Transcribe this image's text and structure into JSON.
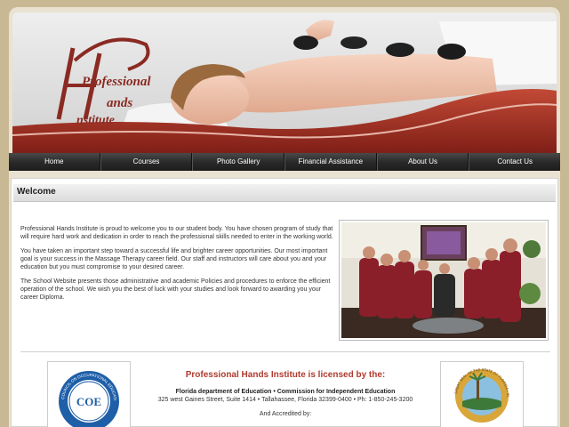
{
  "brand": {
    "logo_line1": "Professional",
    "logo_line2": "ands",
    "logo_line3": "nstitute"
  },
  "nav": {
    "items": [
      {
        "label": "Home"
      },
      {
        "label": "Courses"
      },
      {
        "label": "Photo Gallery"
      },
      {
        "label": "Financial Assistance"
      },
      {
        "label": "About Us"
      },
      {
        "label": "Contact Us"
      }
    ]
  },
  "welcome": {
    "title": "Welcome",
    "paragraphs": [
      "Professional Hands Institute is proud to welcome you to our student body. You have chosen program of study that will require hard work and dedication in order to reach the professional skills needed to enter in the working world.",
      "You have taken an important step toward a successful life and brighter career opportunities. Our most important goal is your success in the Massage Therapy career field. Our staff and instructors will care about you and your education but you must compromise to your desired career.",
      "The School Website presents those administrative and academic Policies and procedures to enforce the efficient operation of the school. We wish you the best of luck with your studies and look forward to awarding you your career Diploma."
    ]
  },
  "license": {
    "title": "Professional Hands Institute is licensed by the:",
    "line1": "Florida department of Education • Commission for Independent Education",
    "line2": "325 west Gaines Street, Suite 1414 • Tallahassee, Florida 32399-0400 • Ph: 1-850-245-3200",
    "line3": "And Accredited by:"
  },
  "badges": {
    "left_text": "COE",
    "left_ring_text": "COUNCIL ON OCCUPATIONAL EDUCATION",
    "right_ring_text": "GREAT SEAL OF THE STATE OF FLORIDA • IN GOD WE TRUST"
  },
  "colors": {
    "brand_red": "#8a2a22",
    "accent_red": "#b03a2e",
    "nav_dark": "#2a2a2a"
  }
}
